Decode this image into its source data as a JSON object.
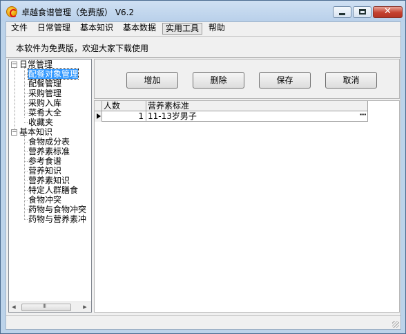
{
  "window": {
    "title": "卓越食谱管理（免费版） V6.2"
  },
  "menu": {
    "items": [
      "文件",
      "日常管理",
      "基本知识",
      "基本数据",
      "实用工具",
      "帮助"
    ],
    "active_index": 4
  },
  "notice": {
    "text": "本软件为免费版，欢迎大家下载使用"
  },
  "tree": {
    "groups": [
      {
        "label": "日常管理",
        "expander": "⊟",
        "children": [
          "配餐对象管理",
          "配餐管理",
          "采购管理",
          "采购入库",
          "菜肴大全",
          "收藏夹"
        ]
      },
      {
        "label": "基本知识",
        "expander": "⊟",
        "children": [
          "食物成分表",
          "营养素标准",
          "参考食谱",
          "营养知识",
          "营养素知识",
          "特定人群膳食",
          "食物冲突",
          "药物与食物冲突",
          "药物与营养素冲"
        ]
      }
    ],
    "selected": "配餐对象管理",
    "scrollbar": {
      "left_arrow": "◀",
      "right_arrow": "▶",
      "thumb_grip": "III"
    }
  },
  "toolbar": {
    "add_label": "增加",
    "delete_label": "删除",
    "save_label": "保存",
    "cancel_label": "取消"
  },
  "grid": {
    "columns": [
      "人数",
      "营养素标准"
    ],
    "rows": [
      {
        "count": "1",
        "standard": "11-13岁男子",
        "ellipsis": "···"
      }
    ]
  },
  "colors": {
    "titlebar": "#bcd3ea",
    "selection": "#3399ff",
    "close_button": "#c4402f"
  }
}
